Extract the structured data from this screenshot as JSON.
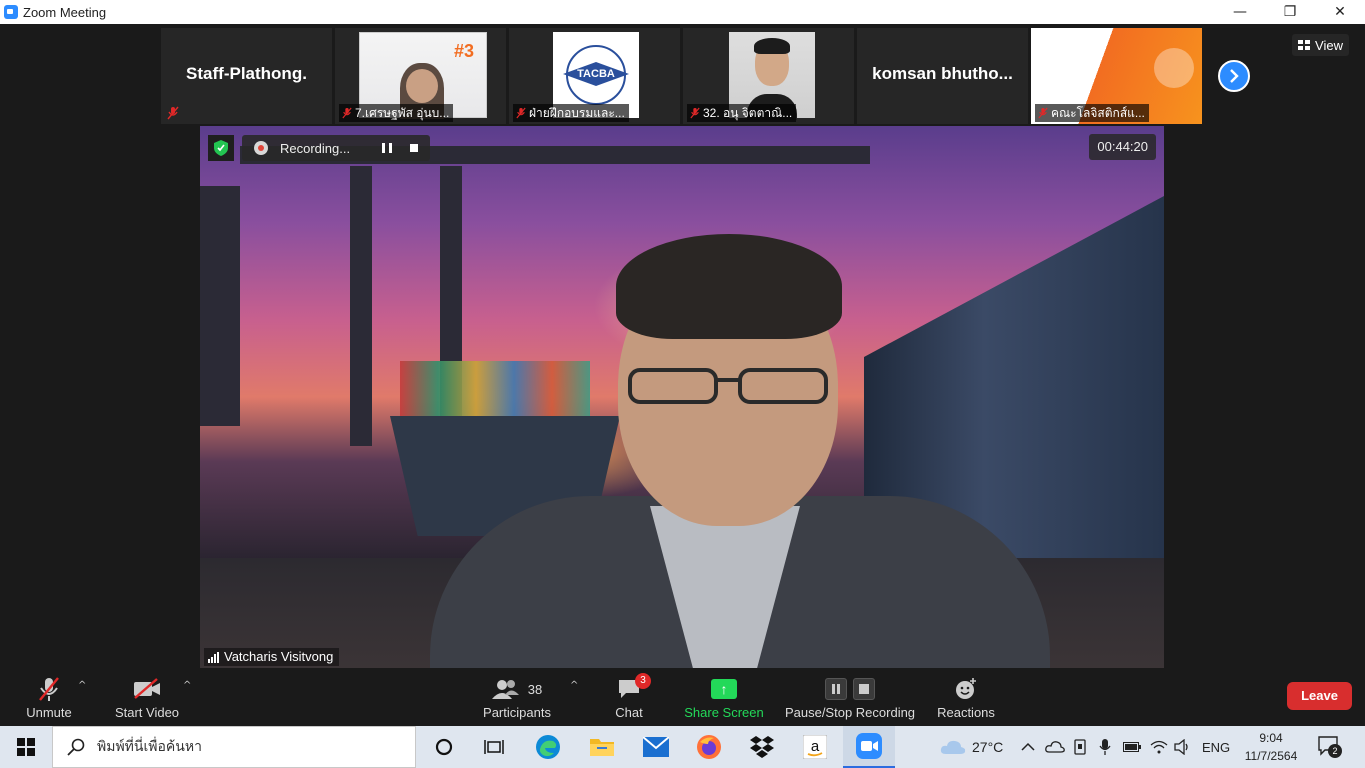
{
  "window": {
    "title": "Zoom Meeting",
    "minimize": "—",
    "maximize": "❐",
    "close": "✕"
  },
  "thumbnails": [
    {
      "type": "name",
      "name": "Staff-Plathong."
    },
    {
      "type": "image",
      "label": "7.เศรษฐพัส อุ่นบ..."
    },
    {
      "type": "image",
      "label": "ฝ่ายฝึกอบรมและ...",
      "logo_text": "TACBA"
    },
    {
      "type": "image",
      "label": "32. อนุ จิตตาณิ..."
    },
    {
      "type": "name",
      "name": "komsan  bhutho..."
    },
    {
      "type": "image",
      "label": "คณะโลจิสติกส์แ..."
    }
  ],
  "view_label": "View",
  "recording": {
    "label": "Recording..."
  },
  "timer": "00:44:20",
  "active_speaker": "Vatcharis Visitvong",
  "toolbar": {
    "unmute": "Unmute",
    "start_video": "Start Video",
    "participants": "Participants",
    "participants_count": "38",
    "chat": "Chat",
    "chat_badge": "3",
    "share_screen": "Share Screen",
    "pause_stop_recording": "Pause/Stop Recording",
    "reactions": "Reactions",
    "leave": "Leave"
  },
  "taskbar": {
    "search_placeholder": "พิมพ์ที่นี่เพื่อค้นหา",
    "temperature": "27°C",
    "language": "ENG",
    "time": "9:04",
    "date": "11/7/2564",
    "notification_count": "2"
  },
  "colors": {
    "accent_blue": "#2d8cff",
    "share_green": "#23d959",
    "leave_red": "#d82e2e"
  }
}
